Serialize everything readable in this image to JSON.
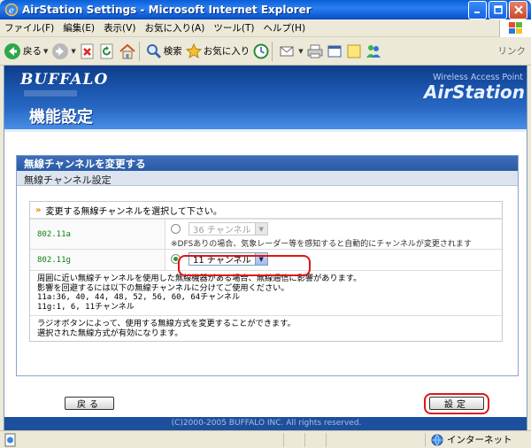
{
  "window": {
    "title": "AirStation Settings - Microsoft Internet Explorer"
  },
  "menu": [
    "ファイル(F)",
    "編集(E)",
    "表示(V)",
    "お気に入り(A)",
    "ツール(T)",
    "ヘルプ(H)"
  ],
  "toolbar": {
    "back_label": "戻る",
    "search_label": "検索",
    "favorites_label": "お気に入り",
    "links_label": "リンク"
  },
  "header": {
    "brand": "BUFFALO",
    "product_tag": "Wireless Access Point",
    "product": "AirStation"
  },
  "page": {
    "title": "機能設定",
    "panel_title": "無線チャンネルを変更する",
    "section_title": "無線チャンネル設定",
    "instruction": "変更する無線チャンネルを選択して下さい。"
  },
  "rows": {
    "a": {
      "label": "802.11a",
      "selected": "36 チャンネル",
      "note": "※DFSありの場合、気象レーダー等を感知すると自動的にチャンネルが変更されます"
    },
    "g": {
      "label": "802.11g",
      "selected": "11 チャンネル"
    }
  },
  "notes": {
    "n1": "周囲に近い無線チャンネルを使用した無線機器がある場合、無線通信に影響があります。",
    "n2": "影響を回避するには以下の無線チャンネルに分けてご使用ください。",
    "n3": "11a:36, 40, 44, 48, 52, 56, 60, 64チャンネル",
    "n4": "11g:1, 6, 11チャンネル",
    "n5": "ラジオボタンによって、使用する無線方式を変更することができます。",
    "n6": "選択された無線方式が有効になります。"
  },
  "buttons": {
    "back": "戻る",
    "submit": "設定"
  },
  "footer": {
    "copyright": "(C)2000-2005 BUFFALO INC. All rights reserved."
  },
  "status": {
    "zone": "インターネット"
  },
  "colors": {
    "header_blue": "#1c58b0",
    "highlight": "#e01616",
    "label_green": "#108010"
  }
}
